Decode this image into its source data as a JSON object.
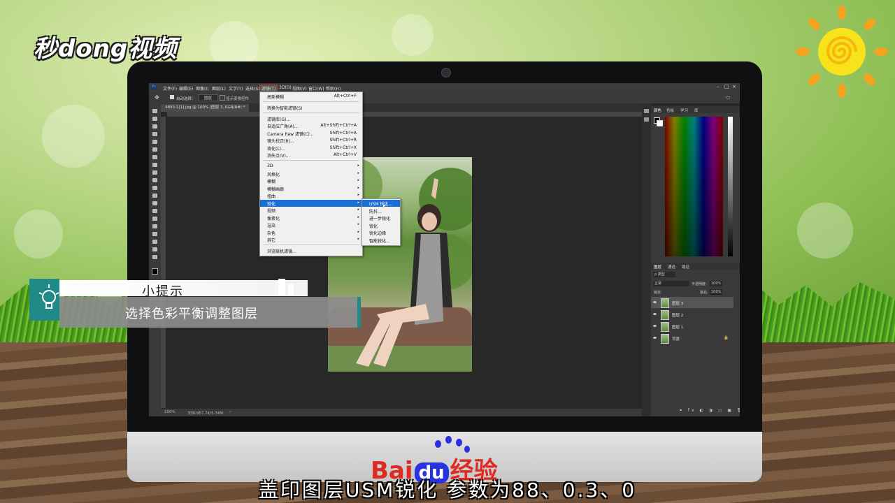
{
  "watermark": {
    "logo_text": "秒dong视频"
  },
  "photoshop": {
    "menus": [
      "文件(F)",
      "编辑(E)",
      "图像(I)",
      "图层(L)",
      "文字(Y)",
      "选择(S)",
      "滤镜(T)",
      "3D(D)",
      "视图(V)",
      "窗口(W)",
      "帮助(H)"
    ],
    "active_menu": "滤镜(T)",
    "options": {
      "auto_select": "自动选择：",
      "layer_group": "图层",
      "show_transform": "显示变换控件"
    },
    "doc_tab": "4893-1[1].jpg @ 100% (图层 3, RGB/8#) *",
    "status_zoom": "100%",
    "status_doc": "文档:957.7K/3.74M",
    "panel_tabs_top": [
      "颜色",
      "色板",
      "学习",
      "库"
    ],
    "panel_tabs_layers": [
      "图层",
      "通道",
      "路径"
    ],
    "layer_controls": {
      "kind": "ρ 类型",
      "mode": "正常",
      "opacity_label": "不透明度:",
      "opacity_value": "100%",
      "lock_label": "锁定:",
      "fill_label": "填充:",
      "fill_value": "100%"
    },
    "layers": [
      {
        "name": "图层 3",
        "selected": true
      },
      {
        "name": "图层 2",
        "selected": false
      },
      {
        "name": "图层 1",
        "selected": false
      },
      {
        "name": "背景",
        "selected": false
      }
    ],
    "filter_menu": {
      "top": [
        {
          "label": "高斯模糊",
          "shortcut": "Alt+Ctrl+F"
        }
      ],
      "convert": {
        "label": "转换为智能滤镜(S)"
      },
      "group2": [
        {
          "label": "滤镜库(G)...",
          "shortcut": ""
        },
        {
          "label": "自适应广角(A)...",
          "shortcut": "Alt+Shift+Ctrl+A"
        },
        {
          "label": "Camera Raw 滤镜(C)...",
          "shortcut": "Shift+Ctrl+A"
        },
        {
          "label": "镜头校正(R)...",
          "shortcut": "Shift+Ctrl+R"
        },
        {
          "label": "液化(L)...",
          "shortcut": "Shift+Ctrl+X"
        },
        {
          "label": "消失点(V)...",
          "shortcut": "Alt+Ctrl+V"
        }
      ],
      "submenus": [
        "3D",
        "风格化",
        "模糊",
        "模糊画廊",
        "扭曲",
        "锐化",
        "视频",
        "像素化",
        "渲染",
        "杂色",
        "其它"
      ],
      "highlighted": "锐化",
      "browse": "浏览联机滤镜..."
    },
    "sharpen_submenu": [
      "USM 锐化...",
      "防抖...",
      "进一步锐化",
      "锐化",
      "锐化边缘",
      "智能锐化..."
    ],
    "sharpen_highlighted": "USM 锐化..."
  },
  "tip": {
    "title": "小提示",
    "body": "选择色彩平衡调整图层"
  },
  "brand": {
    "baidu_left": "Bai",
    "baidu_du": "du",
    "baidu_right": "经验"
  },
  "subtitle": "盖印图层USM锐化  参数为88、0.3、0"
}
